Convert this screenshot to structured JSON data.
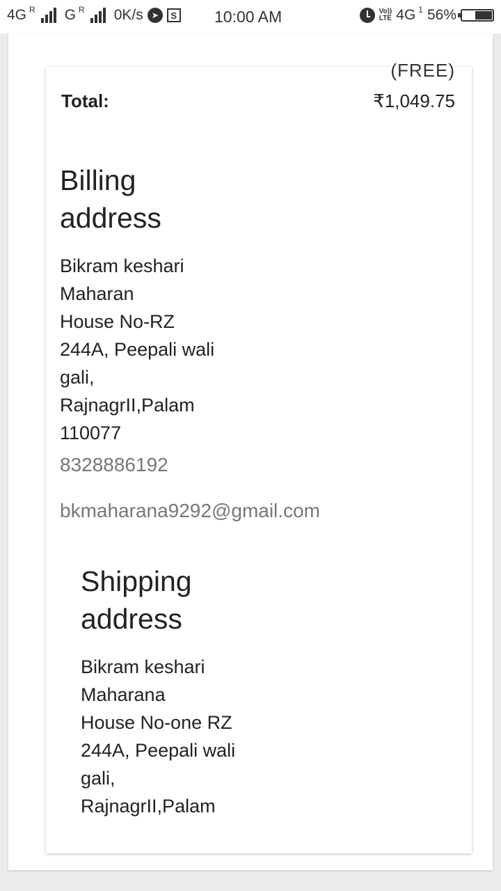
{
  "status_bar": {
    "net1": "4G",
    "net1_sup": "R",
    "net2": "G",
    "net2_sup": "R",
    "speed": "0K/s",
    "time": "10:00 AM",
    "volte_top": "Vo))",
    "volte_bottom": "LTE",
    "net3": "4G",
    "net3_sup": "1",
    "battery": "56%",
    "battery_level": 0.56
  },
  "order": {
    "shipping_note": "(FREE)",
    "total_label": "Total:",
    "total_value": "₹1,049.75"
  },
  "billing": {
    "title_line1": "Billing",
    "title_line2": "address",
    "lines": [
      "Bikram keshari",
      "Maharan",
      "House No-RZ",
      "244A, Peepali wali",
      "gali,",
      "RajnagrII,Palam",
      "110077"
    ],
    "phone": "8328886192",
    "email": "bkmaharana9292@gmail.com"
  },
  "shipping": {
    "title_line1": "Shipping",
    "title_line2": "address",
    "lines": [
      "Bikram keshari",
      "Maharana",
      "House No-one RZ",
      "244A, Peepali wali",
      "gali,",
      "RajnagrII,Palam"
    ]
  }
}
